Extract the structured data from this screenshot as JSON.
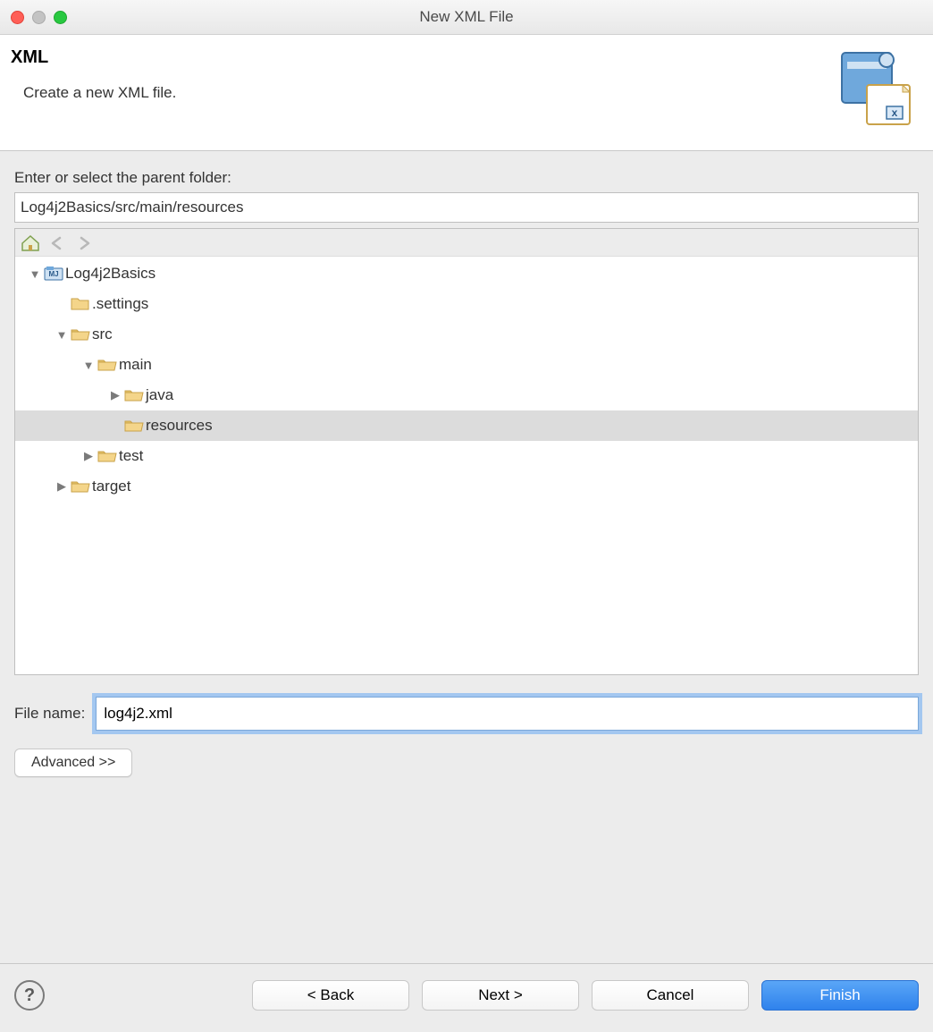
{
  "window": {
    "title": "New XML File"
  },
  "banner": {
    "heading": "XML",
    "subtitle": "Create a new XML file."
  },
  "parent": {
    "label": "Enter or select the parent folder:",
    "value": "Log4j2Basics/src/main/resources"
  },
  "tree": {
    "root": "Log4j2Basics",
    "nodes": [
      {
        "depth": 0,
        "label": "Log4j2Basics",
        "expanded": true,
        "icon": "project"
      },
      {
        "depth": 1,
        "label": ".settings",
        "expanded": null,
        "icon": "folder"
      },
      {
        "depth": 1,
        "label": "src",
        "expanded": true,
        "icon": "folder-open"
      },
      {
        "depth": 2,
        "label": "main",
        "expanded": true,
        "icon": "folder-open"
      },
      {
        "depth": 3,
        "label": "java",
        "expanded": false,
        "icon": "folder-open"
      },
      {
        "depth": 3,
        "label": "resources",
        "expanded": null,
        "icon": "folder-open",
        "selected": true
      },
      {
        "depth": 2,
        "label": "test",
        "expanded": false,
        "icon": "folder-open"
      },
      {
        "depth": 1,
        "label": "target",
        "expanded": false,
        "icon": "folder-open"
      }
    ]
  },
  "filename": {
    "label": "File name:",
    "value": "log4j2.xml"
  },
  "buttons": {
    "advanced": "Advanced >>",
    "back": "< Back",
    "next": "Next >",
    "cancel": "Cancel",
    "finish": "Finish"
  }
}
